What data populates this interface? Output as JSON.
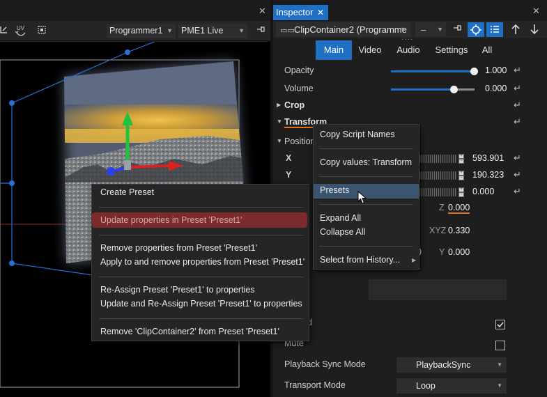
{
  "left_panel": {
    "close": "✕",
    "toolbar": {
      "uv_label": "UV",
      "programmer_select": "Programmer1",
      "pme_select": "PME1 Live"
    }
  },
  "inspector": {
    "tab_title": "Inspector",
    "tab_close": "✕",
    "panel_close": "✕",
    "object_select": "ClipContainer2 (Programme",
    "minus_select": "–",
    "tabs": [
      "Main",
      "Video",
      "Audio",
      "Settings",
      "All"
    ],
    "active_tab": "Main",
    "properties": {
      "opacity": {
        "label": "Opacity",
        "value": "1.000",
        "level": 1.0
      },
      "volume": {
        "label": "Volume",
        "value": "0.000",
        "level": 0.75
      },
      "crop": "Crop",
      "transform": "Transform",
      "position": "Position",
      "x": {
        "label": "X",
        "value": "593.901"
      },
      "y": {
        "label": "Y",
        "value": "190.323"
      },
      "z_row_value": "0.000",
      "z": {
        "label": "Z",
        "value": "0.000"
      },
      "xyz": {
        "label": "XYZ",
        "value": "0.330"
      },
      "rot_x_fragment": "0",
      "rot_y": {
        "label": "Y",
        "value": "0.000"
      },
      "partial_label": "d",
      "mute": "Mute",
      "playback_sync_mode": {
        "label": "Playback Sync Mode",
        "value": "PlaybackSync"
      },
      "transport_mode": {
        "label": "Transport Mode",
        "value": "Loop"
      }
    },
    "reset_icon": "↵"
  },
  "preset_menu": {
    "items": [
      "Create Preset",
      "Update properties in Preset 'Preset1'",
      "Remove properties from Preset 'Preset1'",
      "Apply to and remove properties from Preset 'Preset1'",
      "Re-Assign Preset 'Preset1' to properties",
      "Update and Re-Assign Preset 'Preset1' to properties",
      "Remove 'ClipContainer2' from Preset 'Preset1'"
    ],
    "highlight_color": "#7b2b2c"
  },
  "context_menu": {
    "items": [
      "Copy Script Names",
      "Copy values: Transform",
      "Presets",
      "Expand All",
      "Collapse All",
      "Select from History..."
    ],
    "hovered": "Presets"
  },
  "colors": {
    "accent": "#1f6fc5",
    "underline": "#e8711f",
    "gizmo_x": "#e02020",
    "gizmo_y": "#22c23a",
    "gizmo_z": "#2a3ff0",
    "bounds": "#2a6fd6"
  }
}
